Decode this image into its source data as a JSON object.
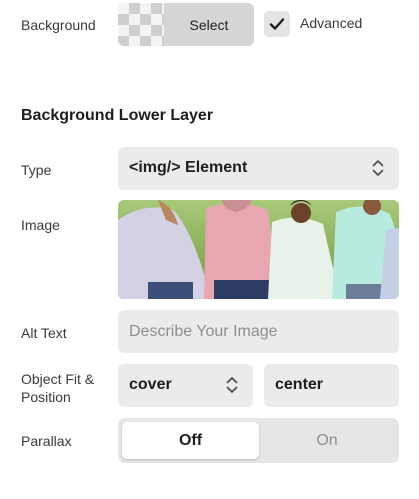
{
  "background": {
    "label": "Background",
    "select_label": "Select",
    "advanced_label": "Advanced",
    "advanced_checked": true
  },
  "section": {
    "title": "Background Lower Layer"
  },
  "type_field": {
    "label": "Type",
    "value": "<img/> Element"
  },
  "image_field": {
    "label": "Image"
  },
  "alt_text": {
    "label": "Alt Text",
    "placeholder": "Describe Your Image",
    "value": ""
  },
  "object_fit": {
    "label_line1": "Object Fit &",
    "label_line2": "Position",
    "fit_value": "cover",
    "position_value": "center"
  },
  "parallax": {
    "label": "Parallax",
    "options": [
      "Off",
      "On"
    ],
    "selected": "Off"
  },
  "colors": {
    "field_bg": "#ebebeb",
    "toggle_track": "#e6e6e6",
    "toggle_selected": "#ffffff",
    "muted_text": "#8e8e8e"
  }
}
